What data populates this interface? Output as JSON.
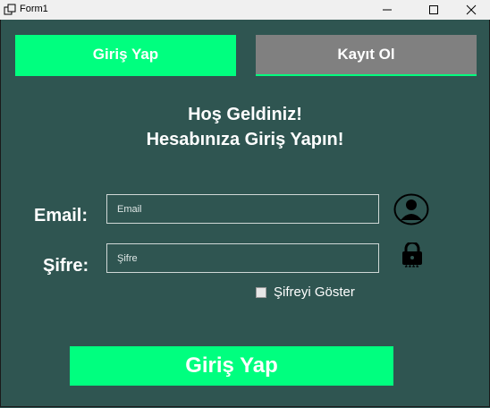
{
  "window": {
    "title": "Form1"
  },
  "tabs": {
    "login_label": "Giriş Yap",
    "register_label": "Kayıt Ol"
  },
  "welcome": {
    "line1": "Hoş Geldiniz!",
    "line2": "Hesabınıza Giriş Yapın!"
  },
  "form": {
    "email_label": "Email:",
    "email_placeholder": "Email",
    "password_label": "Şifre:",
    "password_placeholder": "Şifre",
    "show_password_label": "Şifreyi Göster",
    "submit_label": "Giriş Yap",
    "password_icon_caption": "****"
  },
  "icons": {
    "user": "user-avatar-icon",
    "lock": "lock-icon"
  },
  "colors": {
    "accent": "#00ff7f",
    "background": "#2f5551",
    "inactive_tab": "#808080"
  }
}
